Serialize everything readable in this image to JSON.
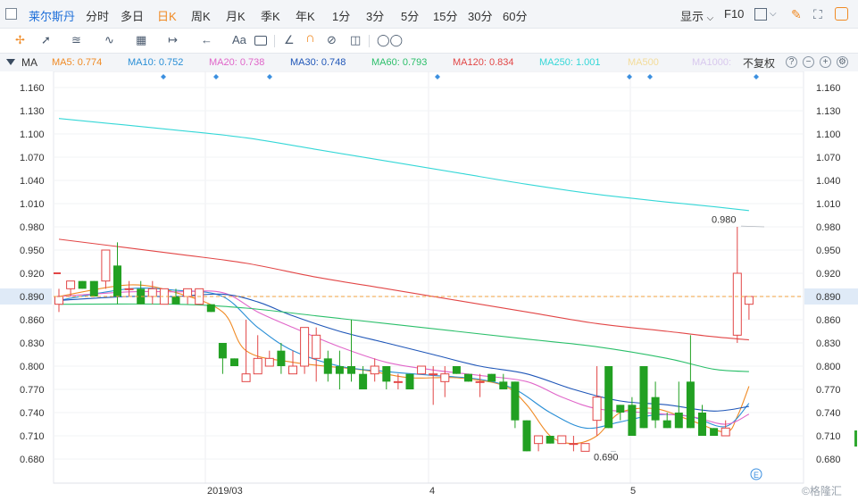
{
  "toolbar": {
    "symbol": "莱尔斯丹",
    "periods": [
      "分时",
      "多日",
      "日K",
      "周K",
      "月K",
      "季K",
      "年K",
      "1分",
      "3分",
      "5分",
      "15分",
      "30分",
      "60分"
    ],
    "active_period": "日K",
    "display_label": "显示",
    "f10_label": "F10"
  },
  "drawing_tools": [
    "crosshair-icon",
    "line-icon",
    "channel-icon",
    "wave-icon",
    "measure-icon",
    "range-icon",
    "arrow-left-icon",
    "text-icon",
    "comment-icon",
    "ruler-icon",
    "magnet-icon",
    "hide-icon",
    "trash-icon",
    "link-icon"
  ],
  "drawing_text_tool": "Aa",
  "ma_legend": {
    "title": "MA",
    "items": [
      {
        "label": "MA5: 0.774",
        "color": "#f08a24"
      },
      {
        "label": "MA10: 0.752",
        "color": "#2a8fd6"
      },
      {
        "label": "MA20: 0.738",
        "color": "#e066c9"
      },
      {
        "label": "MA30: 0.748",
        "color": "#1f56b8"
      },
      {
        "label": "MA60: 0.793",
        "color": "#2bbf6a"
      },
      {
        "label": "MA120: 0.834",
        "color": "#e24646"
      },
      {
        "label": "MA250: 1.001",
        "color": "#35d7d7"
      },
      {
        "label": "MA500",
        "color": "#f3dc9a"
      },
      {
        "label": "MA1000:",
        "color": "#d8c8ee"
      }
    ],
    "adjust_label": "不复权"
  },
  "chart_data": {
    "type": "candlestick",
    "ylim": [
      0.65,
      1.18
    ],
    "y_ticks": [
      "1.160",
      "1.130",
      "1.100",
      "1.070",
      "1.040",
      "1.010",
      "0.980",
      "0.950",
      "0.920",
      "0.890",
      "0.860",
      "0.830",
      "0.800",
      "0.770",
      "0.740",
      "0.710",
      "0.680"
    ],
    "x_tick_labels": [
      "2019/03",
      "4",
      "5"
    ],
    "current_price": "0.890",
    "high_annotation": "0.980",
    "low_annotation": "0.690",
    "up_color": "#e24646",
    "down_color": "#22a022",
    "candles": [
      {
        "o": 0.88,
        "c": 0.89,
        "h": 0.9,
        "l": 0.87
      },
      {
        "o": 0.9,
        "c": 0.91,
        "h": 0.91,
        "l": 0.89
      },
      {
        "o": 0.91,
        "c": 0.9,
        "h": 0.91,
        "l": 0.9
      },
      {
        "o": 0.91,
        "c": 0.89,
        "h": 0.91,
        "l": 0.89
      },
      {
        "o": 0.91,
        "c": 0.95,
        "h": 0.95,
        "l": 0.9
      },
      {
        "o": 0.93,
        "c": 0.89,
        "h": 0.96,
        "l": 0.88
      },
      {
        "o": 0.9,
        "c": 0.9,
        "h": 0.91,
        "l": 0.89
      },
      {
        "o": 0.9,
        "c": 0.88,
        "h": 0.91,
        "l": 0.88
      },
      {
        "o": 0.89,
        "c": 0.9,
        "h": 0.91,
        "l": 0.88
      },
      {
        "o": 0.88,
        "c": 0.9,
        "h": 0.9,
        "l": 0.88
      },
      {
        "o": 0.89,
        "c": 0.88,
        "h": 0.9,
        "l": 0.88
      },
      {
        "o": 0.89,
        "c": 0.9,
        "h": 0.9,
        "l": 0.88
      },
      {
        "o": 0.88,
        "c": 0.9,
        "h": 0.9,
        "l": 0.88
      },
      {
        "o": 0.88,
        "c": 0.87,
        "h": 0.88,
        "l": 0.87
      },
      {
        "o": 0.83,
        "c": 0.81,
        "h": 0.83,
        "l": 0.79
      },
      {
        "o": 0.81,
        "c": 0.8,
        "h": 0.81,
        "l": 0.8
      },
      {
        "o": 0.78,
        "c": 0.79,
        "h": 0.86,
        "l": 0.78
      },
      {
        "o": 0.79,
        "c": 0.81,
        "h": 0.84,
        "l": 0.79
      },
      {
        "o": 0.8,
        "c": 0.81,
        "h": 0.82,
        "l": 0.8
      },
      {
        "o": 0.82,
        "c": 0.8,
        "h": 0.83,
        "l": 0.79
      },
      {
        "o": 0.79,
        "c": 0.8,
        "h": 0.82,
        "l": 0.79
      },
      {
        "o": 0.8,
        "c": 0.85,
        "h": 0.85,
        "l": 0.79
      },
      {
        "o": 0.81,
        "c": 0.84,
        "h": 0.85,
        "l": 0.78
      },
      {
        "o": 0.81,
        "c": 0.79,
        "h": 0.82,
        "l": 0.78
      },
      {
        "o": 0.8,
        "c": 0.79,
        "h": 0.82,
        "l": 0.77
      },
      {
        "o": 0.8,
        "c": 0.79,
        "h": 0.86,
        "l": 0.78
      },
      {
        "o": 0.79,
        "c": 0.77,
        "h": 0.8,
        "l": 0.77
      },
      {
        "o": 0.79,
        "c": 0.8,
        "h": 0.81,
        "l": 0.78
      },
      {
        "o": 0.8,
        "c": 0.78,
        "h": 0.8,
        "l": 0.77
      },
      {
        "o": 0.78,
        "c": 0.78,
        "h": 0.79,
        "l": 0.77
      },
      {
        "o": 0.79,
        "c": 0.77,
        "h": 0.79,
        "l": 0.77
      },
      {
        "o": 0.79,
        "c": 0.8,
        "h": 0.8,
        "l": 0.79
      },
      {
        "o": 0.79,
        "c": 0.79,
        "h": 0.8,
        "l": 0.75
      },
      {
        "o": 0.78,
        "c": 0.79,
        "h": 0.8,
        "l": 0.76
      },
      {
        "o": 0.8,
        "c": 0.79,
        "h": 0.8,
        "l": 0.79
      },
      {
        "o": 0.79,
        "c": 0.78,
        "h": 0.79,
        "l": 0.78
      },
      {
        "o": 0.78,
        "c": 0.78,
        "h": 0.79,
        "l": 0.76
      },
      {
        "o": 0.79,
        "c": 0.78,
        "h": 0.79,
        "l": 0.78
      },
      {
        "o": 0.78,
        "c": 0.77,
        "h": 0.79,
        "l": 0.77
      },
      {
        "o": 0.78,
        "c": 0.73,
        "h": 0.78,
        "l": 0.72
      },
      {
        "o": 0.73,
        "c": 0.69,
        "h": 0.73,
        "l": 0.69
      },
      {
        "o": 0.7,
        "c": 0.71,
        "h": 0.71,
        "l": 0.69
      },
      {
        "o": 0.71,
        "c": 0.7,
        "h": 0.71,
        "l": 0.7
      },
      {
        "o": 0.7,
        "c": 0.71,
        "h": 0.71,
        "l": 0.7
      },
      {
        "o": 0.7,
        "c": 0.7,
        "h": 0.71,
        "l": 0.69
      },
      {
        "o": 0.69,
        "c": 0.7,
        "h": 0.7,
        "l": 0.69
      },
      {
        "o": 0.73,
        "c": 0.76,
        "h": 0.8,
        "l": 0.71
      },
      {
        "o": 0.8,
        "c": 0.72,
        "h": 0.8,
        "l": 0.72
      },
      {
        "o": 0.75,
        "c": 0.74,
        "h": 0.75,
        "l": 0.73
      },
      {
        "o": 0.75,
        "c": 0.71,
        "h": 0.76,
        "l": 0.71
      },
      {
        "o": 0.8,
        "c": 0.72,
        "h": 0.8,
        "l": 0.72
      },
      {
        "o": 0.76,
        "c": 0.73,
        "h": 0.78,
        "l": 0.72
      },
      {
        "o": 0.73,
        "c": 0.72,
        "h": 0.74,
        "l": 0.72
      },
      {
        "o": 0.74,
        "c": 0.72,
        "h": 0.78,
        "l": 0.72
      },
      {
        "o": 0.78,
        "c": 0.72,
        "h": 0.84,
        "l": 0.72
      },
      {
        "o": 0.74,
        "c": 0.71,
        "h": 0.75,
        "l": 0.71
      },
      {
        "o": 0.72,
        "c": 0.71,
        "h": 0.72,
        "l": 0.71
      },
      {
        "o": 0.71,
        "c": 0.72,
        "h": 0.73,
        "l": 0.71
      },
      {
        "o": 0.84,
        "c": 0.92,
        "h": 0.98,
        "l": 0.83
      },
      {
        "o": 0.88,
        "c": 0.89,
        "h": 0.89,
        "l": 0.86
      }
    ],
    "ma_series": [
      {
        "name": "MA5",
        "color": "#f08a24",
        "points": [
          [
            0,
            0.89
          ],
          [
            6,
            0.905
          ],
          [
            10,
            0.895
          ],
          [
            14,
            0.87
          ],
          [
            16,
            0.82
          ],
          [
            20,
            0.805
          ],
          [
            26,
            0.795
          ],
          [
            30,
            0.785
          ],
          [
            34,
            0.785
          ],
          [
            38,
            0.775
          ],
          [
            40,
            0.75
          ],
          [
            42,
            0.71
          ],
          [
            44,
            0.7
          ],
          [
            46,
            0.71
          ],
          [
            48,
            0.74
          ],
          [
            51,
            0.745
          ],
          [
            54,
            0.73
          ],
          [
            57,
            0.715
          ],
          [
            58,
            0.735
          ],
          [
            59,
            0.774
          ]
        ]
      },
      {
        "name": "MA10",
        "color": "#2a8fd6",
        "points": [
          [
            0,
            0.885
          ],
          [
            6,
            0.9
          ],
          [
            10,
            0.898
          ],
          [
            14,
            0.89
          ],
          [
            17,
            0.85
          ],
          [
            20,
            0.82
          ],
          [
            24,
            0.8
          ],
          [
            28,
            0.793
          ],
          [
            32,
            0.788
          ],
          [
            36,
            0.783
          ],
          [
            39,
            0.77
          ],
          [
            42,
            0.74
          ],
          [
            45,
            0.72
          ],
          [
            48,
            0.728
          ],
          [
            51,
            0.737
          ],
          [
            54,
            0.735
          ],
          [
            57,
            0.722
          ],
          [
            59,
            0.752
          ]
        ]
      },
      {
        "name": "MA20",
        "color": "#e066c9",
        "points": [
          [
            0,
            0.89
          ],
          [
            6,
            0.896
          ],
          [
            10,
            0.896
          ],
          [
            14,
            0.895
          ],
          [
            17,
            0.87
          ],
          [
            20,
            0.85
          ],
          [
            24,
            0.825
          ],
          [
            28,
            0.805
          ],
          [
            32,
            0.795
          ],
          [
            36,
            0.788
          ],
          [
            40,
            0.78
          ],
          [
            43,
            0.76
          ],
          [
            46,
            0.745
          ],
          [
            50,
            0.74
          ],
          [
            54,
            0.735
          ],
          [
            57,
            0.725
          ],
          [
            59,
            0.738
          ]
        ]
      },
      {
        "name": "MA30",
        "color": "#1f56b8",
        "points": [
          [
            0,
            0.885
          ],
          [
            6,
            0.89
          ],
          [
            10,
            0.89
          ],
          [
            14,
            0.893
          ],
          [
            17,
            0.883
          ],
          [
            20,
            0.865
          ],
          [
            24,
            0.845
          ],
          [
            28,
            0.83
          ],
          [
            32,
            0.815
          ],
          [
            36,
            0.8
          ],
          [
            40,
            0.79
          ],
          [
            44,
            0.77
          ],
          [
            48,
            0.755
          ],
          [
            52,
            0.75
          ],
          [
            56,
            0.742
          ],
          [
            59,
            0.748
          ]
        ]
      },
      {
        "name": "MA60",
        "color": "#2bbf6a",
        "points": [
          [
            0,
            0.88
          ],
          [
            10,
            0.88
          ],
          [
            16,
            0.875
          ],
          [
            22,
            0.865
          ],
          [
            28,
            0.855
          ],
          [
            34,
            0.845
          ],
          [
            40,
            0.835
          ],
          [
            46,
            0.825
          ],
          [
            52,
            0.81
          ],
          [
            56,
            0.796
          ],
          [
            59,
            0.793
          ]
        ]
      },
      {
        "name": "MA120",
        "color": "#e24646",
        "points": [
          [
            0,
            0.964
          ],
          [
            10,
            0.945
          ],
          [
            16,
            0.933
          ],
          [
            22,
            0.915
          ],
          [
            28,
            0.9
          ],
          [
            34,
            0.885
          ],
          [
            40,
            0.87
          ],
          [
            46,
            0.855
          ],
          [
            52,
            0.845
          ],
          [
            56,
            0.838
          ],
          [
            59,
            0.834
          ]
        ]
      },
      {
        "name": "MA250",
        "color": "#35d7d7",
        "points": [
          [
            0,
            1.12
          ],
          [
            10,
            1.105
          ],
          [
            16,
            1.095
          ],
          [
            22,
            1.08
          ],
          [
            28,
            1.065
          ],
          [
            34,
            1.05
          ],
          [
            40,
            1.035
          ],
          [
            46,
            1.022
          ],
          [
            52,
            1.012
          ],
          [
            56,
            1.006
          ],
          [
            59,
            1.001
          ]
        ]
      }
    ]
  },
  "watermark": "©格隆汇"
}
